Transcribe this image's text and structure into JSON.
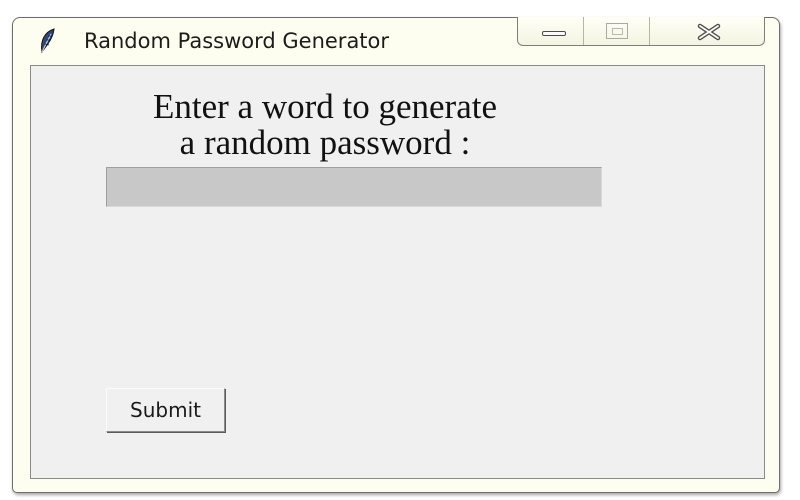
{
  "window": {
    "title": "Random Password Generator",
    "app_icon": "tk-feather-icon",
    "caption_buttons": [
      "minimize-icon",
      "maximize-icon",
      "close-icon"
    ]
  },
  "form": {
    "prompt_line1": "Enter a word to generate",
    "prompt_line2": "a random password :",
    "entry_value": "",
    "submit_label": "Submit"
  },
  "colors": {
    "client_background": "#f0f0f0",
    "entry_background": "#c8c8c8",
    "title_bar": "#fefef0"
  }
}
